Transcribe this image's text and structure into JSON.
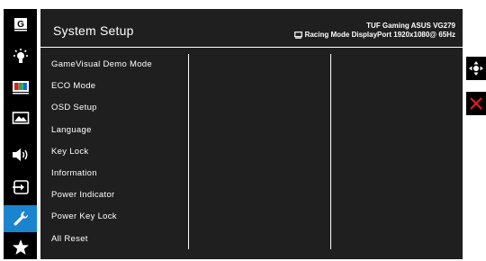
{
  "sidebar": {
    "items": [
      {
        "icon": "gaming-mode-icon",
        "active": false
      },
      {
        "icon": "brightness-icon",
        "active": false
      },
      {
        "icon": "color-icon",
        "active": false
      },
      {
        "icon": "image-icon",
        "active": false
      },
      {
        "icon": "sound-icon",
        "active": false
      },
      {
        "icon": "input-select-icon",
        "active": false
      },
      {
        "icon": "wrench-icon",
        "active": true
      },
      {
        "icon": "star-icon",
        "active": false
      }
    ]
  },
  "header": {
    "title": "System Setup",
    "model": "TUF Gaming ASUS VG279",
    "status": "Racing Mode DisplayPort 1920x1080@ 65Hz"
  },
  "menu": {
    "items": [
      "GameVisual Demo Mode",
      "ECO Mode",
      "OSD Setup",
      "Language",
      "Key Lock",
      "Information",
      "Power Indicator",
      "Power Key Lock",
      "All Reset"
    ]
  },
  "controls": {
    "navigate_icon": "navigate-icon",
    "close_icon": "close-icon",
    "accent_color": "#1a84ce",
    "close_color": "#e0201e"
  }
}
